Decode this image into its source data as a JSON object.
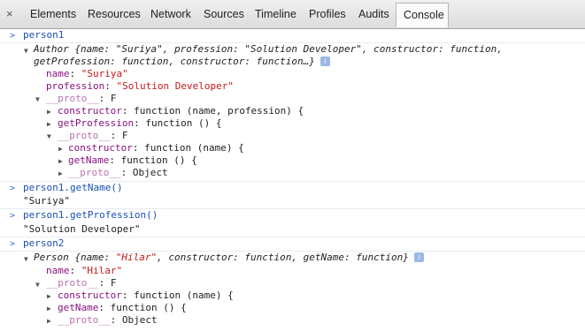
{
  "toolbar": {
    "close_icon": "×",
    "tabs": [
      "Elements",
      "Resources",
      "Network",
      "Sources",
      "Timeline",
      "Profiles",
      "Audits",
      "Console"
    ],
    "active_tab": "Console"
  },
  "console": {
    "cmd1": "person1",
    "author_type": "Author",
    "author_summary_1": " {name: \"Suriya\", profession: \"Solution Developer\", constructor: function,",
    "author_summary_2": "getProfession: function, constructor: function…}",
    "info_icon": "i",
    "name_key": "name",
    "name_val": "\"Suriya\"",
    "profession_key": "profession",
    "profession_val": "\"Solution Developer\"",
    "proto_key": "__proto__",
    "proto_val": "F",
    "ctor_key": "constructor",
    "ctor_val_author": "function (name, profession) {",
    "getprof_key": "getProfession",
    "fn_empty": "function () {",
    "ctor_val_person": "function (name) {",
    "getname_key": "getName",
    "object_val": "Object",
    "cmd2": "person1.getName()",
    "out2": "\"Suriya\"",
    "cmd3": "person1.getProfession()",
    "out3": "\"Solution Developer\"",
    "cmd4": "person2",
    "person_type": "Person",
    "person_summary_pre": " {name: ",
    "person_summary_name": "\"Hilar\"",
    "person_summary_post": ", constructor: function, getName: function}",
    "name_val_hilar": "\"Hilar\""
  }
}
